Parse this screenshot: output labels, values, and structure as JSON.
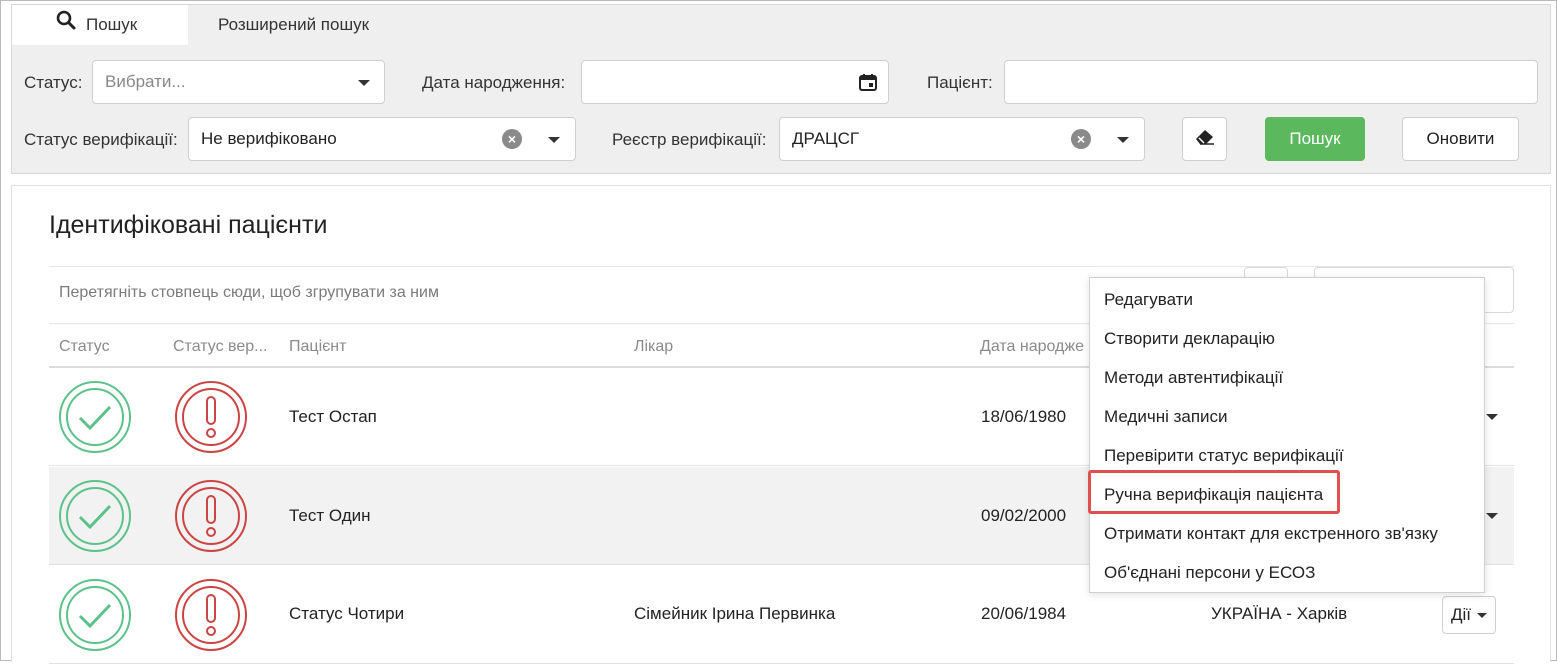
{
  "tabs": {
    "search": "Пошук",
    "advanced": "Розширений пошук"
  },
  "filters": {
    "status_label": "Статус:",
    "status_placeholder": "Вибрати...",
    "birthdate_label": "Дата народження:",
    "patient_label": "Пацієнт:",
    "verification_status_label": "Статус верифікації:",
    "verification_status_value": "Не верифіковано",
    "verification_registry_label": "Реєстр верифікації:",
    "verification_registry_value": "ДРАЦСГ",
    "search_button": "Пошук",
    "refresh_button": "Оновити"
  },
  "results": {
    "title": "Ідентифіковані пацієнти",
    "group_hint": "Перетягніть стовпець сюди, щоб згрупувати за ним",
    "columns": [
      "Статус",
      "Статус вер...",
      "Пацієнт",
      "Лікар",
      "Дата народже"
    ],
    "rows": [
      {
        "patient": "Тест Остап",
        "doctor": "",
        "birthdate": "18/06/1980",
        "location": ""
      },
      {
        "patient": "Тест Один",
        "doctor": "",
        "birthdate": "09/02/2000",
        "location": ""
      },
      {
        "patient": "Статус Чотири",
        "doctor": "Сімейник Ірина Первинка",
        "birthdate": "20/06/1984",
        "location": "УКРАЇНА - Харків"
      }
    ],
    "actions_label": "Дії"
  },
  "menu": {
    "items": [
      "Редагувати",
      "Створити декларацію",
      "Методи автентифікації",
      "Медичні записи",
      "Перевірити статус верифікації",
      "Ручна верифікація пацієнта",
      "Отримати контакт для екстренного зв'язку",
      "Об'єднані персони у ЕСОЗ"
    ],
    "highlighted_index": 5
  },
  "colors": {
    "ok_green": "#5cc28a",
    "warn_red": "#cc4444",
    "search_green": "#5cb85c",
    "highlight_red": "#e05050"
  },
  "icons": {
    "search_tab": "search-icon",
    "birthdate": "calendar-icon",
    "clear_filters": "eraser-icon",
    "row_status": "check-circle-icon",
    "row_verification": "exclamation-circle-icon"
  }
}
